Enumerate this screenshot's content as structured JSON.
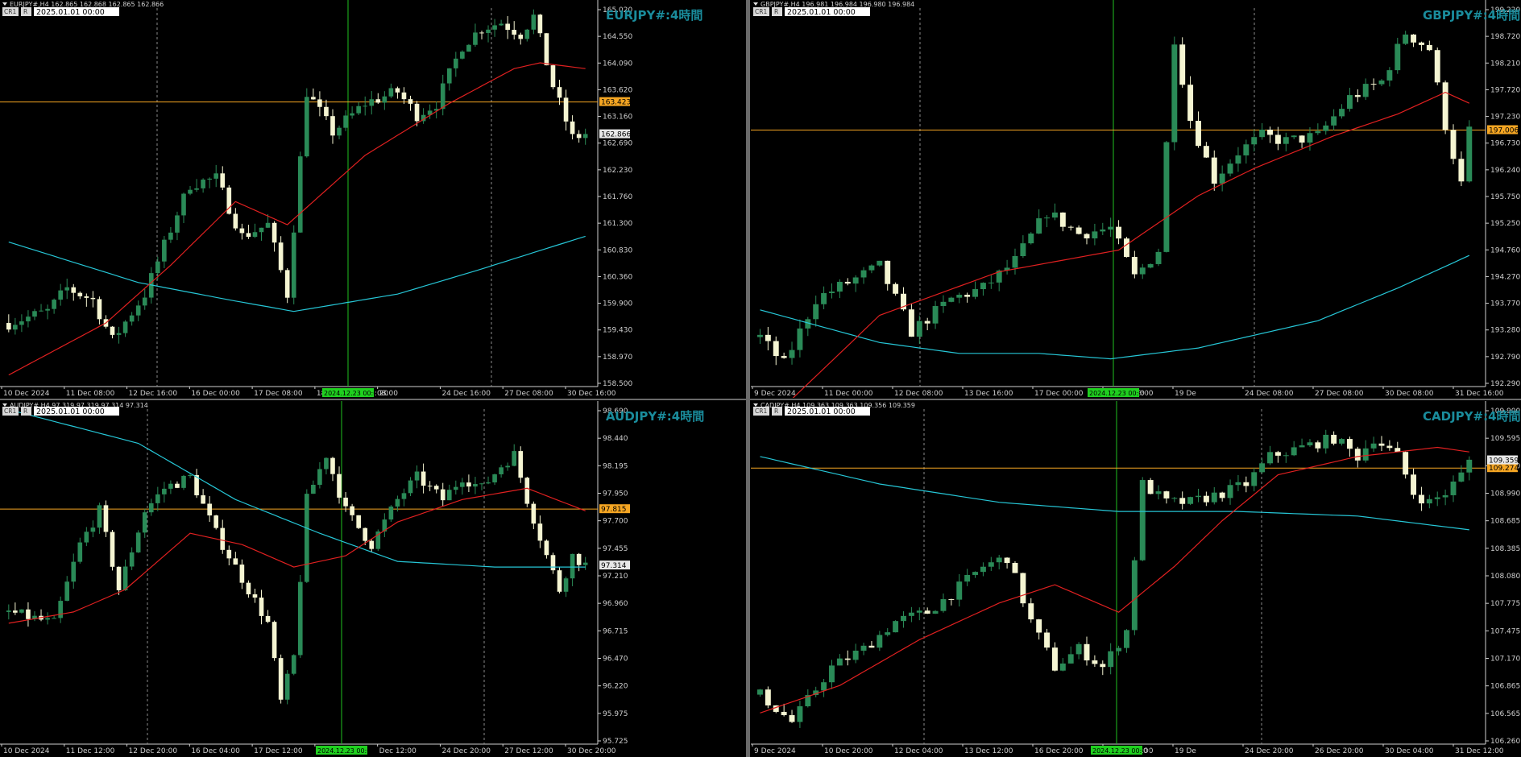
{
  "panes": [
    {
      "id": "eurjpy",
      "header": "EURJPY#,H4  162.865 162.868 162.865 162.866",
      "label": "EURJPY#:4時間",
      "btn_cr": "CR1",
      "btn_r": "R",
      "date_box": "2025.01.01 00:00",
      "price_ticks": [
        "165.020",
        "164.550",
        "164.090",
        "163.620",
        "163.160",
        "162.690",
        "162.230",
        "161.760",
        "161.300",
        "160.830",
        "160.360",
        "159.900",
        "159.430",
        "158.970",
        "158.500"
      ],
      "hline_value": "163.423",
      "current_value": "162.866",
      "time_labels": [
        "10 Dec 2024",
        "11 Dec 08:00",
        "12 Dec 16:00",
        "16 Dec 00:00",
        "17 Dec 08:00",
        "18 Dec 16:00",
        "20",
        "24 Dec 16:00",
        "27 Dec 08:00",
        "30 Dec 16:00"
      ],
      "vline_label": "2024.12.23 00:00",
      "vline_label_tail": ":08:00",
      "chart_data": {
        "type": "candlestick",
        "ylim": [
          158.5,
          165.02
        ],
        "bars": 90,
        "anchors": [
          [
            0,
            159.6
          ],
          [
            6,
            159.8
          ],
          [
            9,
            160.2
          ],
          [
            13,
            160.0
          ],
          [
            16,
            159.3
          ],
          [
            21,
            160.1
          ],
          [
            26,
            161.5
          ],
          [
            28,
            162.0
          ],
          [
            32,
            162.1
          ],
          [
            36,
            161.1
          ],
          [
            40,
            161.3
          ],
          [
            43,
            160.1
          ],
          [
            46,
            163.6
          ],
          [
            50,
            162.9
          ],
          [
            55,
            163.4
          ],
          [
            60,
            163.6
          ],
          [
            63,
            163.2
          ],
          [
            66,
            163.4
          ],
          [
            70,
            164.4
          ],
          [
            73,
            164.7
          ],
          [
            76,
            164.8
          ],
          [
            79,
            164.6
          ],
          [
            81,
            164.9
          ],
          [
            84,
            163.7
          ],
          [
            87,
            162.8
          ],
          [
            89,
            162.87
          ]
        ],
        "ma_fast": [
          [
            0,
            158.7
          ],
          [
            15,
            159.6
          ],
          [
            25,
            160.6
          ],
          [
            35,
            161.7
          ],
          [
            43,
            161.3
          ],
          [
            55,
            162.5
          ],
          [
            68,
            163.4
          ],
          [
            78,
            164.0
          ],
          [
            82,
            164.1
          ],
          [
            89,
            164.0
          ]
        ],
        "ma_slow": [
          [
            0,
            161.0
          ],
          [
            20,
            160.3
          ],
          [
            34,
            160.0
          ],
          [
            44,
            159.8
          ],
          [
            60,
            160.1
          ],
          [
            72,
            160.5
          ],
          [
            89,
            161.1
          ]
        ]
      }
    },
    {
      "id": "gbpjpy",
      "header": "GBPJPY#,H4  196.981 196.984 196.980 196.984",
      "label": "GBPJPY#:4時間",
      "btn_cr": "CR1",
      "btn_r": "R",
      "date_box": "2025.01.01 00:00",
      "price_ticks": [
        "199.220",
        "198.720",
        "198.210",
        "197.720",
        "197.230",
        "196.730",
        "196.240",
        "195.750",
        "195.250",
        "194.760",
        "194.270",
        "193.770",
        "193.280",
        "192.790",
        "192.290"
      ],
      "hline_value": "197.006",
      "current_value": "",
      "time_labels": [
        "9 Dec 2024",
        "11 Dec 00:00",
        "12 Dec 08:00",
        "13 Dec 16:00",
        "17 Dec 00:00",
        "18 Dec 08:00",
        "19 De",
        "24 Dec 08:00",
        "27 Dec 08:00",
        "30 Dec 08:00",
        "31 Dec 16:00"
      ],
      "vline_label": "2024.12.23 00:00",
      "vline_label_tail": "0",
      "chart_data": {
        "type": "candlestick",
        "ylim": [
          192.29,
          199.22
        ],
        "bars": 90,
        "anchors": [
          [
            0,
            193.2
          ],
          [
            3,
            192.7
          ],
          [
            7,
            193.9
          ],
          [
            11,
            194.2
          ],
          [
            15,
            194.5
          ],
          [
            19,
            193.3
          ],
          [
            24,
            193.9
          ],
          [
            28,
            194.1
          ],
          [
            32,
            194.6
          ],
          [
            36,
            195.5
          ],
          [
            40,
            195.1
          ],
          [
            44,
            195.2
          ],
          [
            47,
            194.3
          ],
          [
            50,
            194.8
          ],
          [
            52,
            198.7
          ],
          [
            54,
            197.2
          ],
          [
            57,
            196.1
          ],
          [
            60,
            196.6
          ],
          [
            63,
            196.9
          ],
          [
            66,
            196.8
          ],
          [
            70,
            196.9
          ],
          [
            74,
            197.6
          ],
          [
            78,
            197.9
          ],
          [
            81,
            198.8
          ],
          [
            84,
            198.5
          ],
          [
            86,
            197.1
          ],
          [
            88,
            196.0
          ],
          [
            89,
            196.98
          ]
        ],
        "ma_fast": [
          [
            0,
            191.5
          ],
          [
            15,
            193.6
          ],
          [
            30,
            194.4
          ],
          [
            45,
            194.8
          ],
          [
            55,
            195.8
          ],
          [
            62,
            196.3
          ],
          [
            72,
            196.9
          ],
          [
            80,
            197.3
          ],
          [
            86,
            197.7
          ],
          [
            89,
            197.5
          ]
        ],
        "ma_slow": [
          [
            0,
            193.7
          ],
          [
            15,
            193.1
          ],
          [
            25,
            192.9
          ],
          [
            35,
            192.9
          ],
          [
            44,
            192.8
          ],
          [
            55,
            193.0
          ],
          [
            70,
            193.5
          ],
          [
            80,
            194.1
          ],
          [
            89,
            194.7
          ]
        ]
      }
    },
    {
      "id": "audjpy",
      "header": "AUDJPY#,H4  97.319 97.319 97.314 97.314",
      "label": "AUDJPY#:4時間",
      "btn_cr": "CR1",
      "btn_r": "R",
      "date_box": "2025.01.01 00:00",
      "price_ticks": [
        "98.690",
        "98.440",
        "98.195",
        "97.950",
        "97.700",
        "97.455",
        "97.210",
        "96.960",
        "96.715",
        "96.470",
        "96.220",
        "95.975",
        "95.725"
      ],
      "hline_value": "97.815",
      "current_value": "97.314",
      "time_labels": [
        "10 Dec 2024",
        "11 Dec 12:00",
        "12 Dec 20:00",
        "16 Dec 04:00",
        "17 Dec 12:00",
        "18 Dec 20:00",
        "Dec 12:00",
        "24 Dec 20:00",
        "27 Dec 12:00",
        "30 Dec 20:00"
      ],
      "vline_label": "2024.12.23 00:00",
      "vline_label_tail": "",
      "chart_data": {
        "type": "candlestick",
        "ylim": [
          95.725,
          98.69
        ],
        "bars": 90,
        "anchors": [
          [
            0,
            96.9
          ],
          [
            7,
            96.8
          ],
          [
            11,
            97.5
          ],
          [
            14,
            97.8
          ],
          [
            17,
            97.1
          ],
          [
            21,
            97.8
          ],
          [
            24,
            98.0
          ],
          [
            28,
            98.1
          ],
          [
            32,
            97.6
          ],
          [
            36,
            97.2
          ],
          [
            40,
            96.8
          ],
          [
            42,
            96.1
          ],
          [
            44,
            96.5
          ],
          [
            46,
            97.9
          ],
          [
            49,
            98.3
          ],
          [
            52,
            97.8
          ],
          [
            56,
            97.5
          ],
          [
            60,
            97.9
          ],
          [
            63,
            98.1
          ],
          [
            67,
            97.9
          ],
          [
            70,
            98.1
          ],
          [
            73,
            98.0
          ],
          [
            76,
            98.2
          ],
          [
            78,
            98.3
          ],
          [
            80,
            97.9
          ],
          [
            83,
            97.4
          ],
          [
            85,
            97.1
          ],
          [
            87,
            97.4
          ],
          [
            89,
            97.32
          ]
        ],
        "ma_fast": [
          [
            0,
            96.8
          ],
          [
            10,
            96.9
          ],
          [
            18,
            97.1
          ],
          [
            28,
            97.6
          ],
          [
            36,
            97.5
          ],
          [
            44,
            97.3
          ],
          [
            52,
            97.4
          ],
          [
            60,
            97.7
          ],
          [
            70,
            97.9
          ],
          [
            80,
            98.0
          ],
          [
            89,
            97.8
          ]
        ],
        "ma_slow": [
          [
            0,
            98.7
          ],
          [
            20,
            98.4
          ],
          [
            35,
            97.9
          ],
          [
            48,
            97.6
          ],
          [
            60,
            97.35
          ],
          [
            75,
            97.3
          ],
          [
            89,
            97.3
          ]
        ]
      }
    },
    {
      "id": "cadjpy",
      "header": "CADJPY#,H4  109.363 109.363 109.356 109.359",
      "label": "CADJPY#:4時間",
      "btn_cr": "CR1",
      "btn_r": "R",
      "date_box": "2025.01.01 00:00",
      "price_ticks": [
        "109.900",
        "109.595",
        "109.290",
        "108.990",
        "108.685",
        "108.385",
        "108.080",
        "107.775",
        "107.475",
        "107.170",
        "106.865",
        "106.565",
        "106.260"
      ],
      "hline_value": "109.274",
      "current_value": "109.359",
      "time_labels": [
        "9 Dec 2024",
        "10 Dec 20:00",
        "12 Dec 04:00",
        "13 Dec 12:00",
        "16 Dec 20:00",
        "18 Dec 04:00",
        "19 De",
        "24 Dec 20:00",
        "26 Dec 20:00",
        "30 Dec 04:00",
        "31 Dec 12:00"
      ],
      "vline_label": "2024.12.23 00:00",
      "vline_label_tail": "0",
      "chart_data": {
        "type": "candlestick",
        "ylim": [
          106.26,
          109.9
        ],
        "bars": 90,
        "anchors": [
          [
            0,
            106.8
          ],
          [
            4,
            106.5
          ],
          [
            9,
            107.1
          ],
          [
            13,
            107.3
          ],
          [
            17,
            107.6
          ],
          [
            21,
            107.7
          ],
          [
            24,
            107.9
          ],
          [
            28,
            108.2
          ],
          [
            31,
            108.3
          ],
          [
            34,
            107.6
          ],
          [
            37,
            107.1
          ],
          [
            40,
            107.3
          ],
          [
            43,
            107.1
          ],
          [
            46,
            107.5
          ],
          [
            48,
            109.1
          ],
          [
            51,
            108.9
          ],
          [
            54,
            108.9
          ],
          [
            58,
            109.0
          ],
          [
            61,
            109.1
          ],
          [
            64,
            109.4
          ],
          [
            68,
            109.5
          ],
          [
            72,
            109.6
          ],
          [
            75,
            109.4
          ],
          [
            77,
            109.6
          ],
          [
            80,
            109.4
          ],
          [
            82,
            109.0
          ],
          [
            84,
            108.9
          ],
          [
            86,
            109.0
          ],
          [
            88,
            109.2
          ],
          [
            89,
            109.36
          ]
        ],
        "ma_fast": [
          [
            0,
            106.6
          ],
          [
            10,
            106.9
          ],
          [
            20,
            107.4
          ],
          [
            30,
            107.8
          ],
          [
            37,
            108.0
          ],
          [
            45,
            107.7
          ],
          [
            52,
            108.2
          ],
          [
            58,
            108.7
          ],
          [
            65,
            109.2
          ],
          [
            75,
            109.4
          ],
          [
            85,
            109.5
          ],
          [
            89,
            109.45
          ]
        ],
        "ma_slow": [
          [
            0,
            109.4
          ],
          [
            15,
            109.1
          ],
          [
            30,
            108.9
          ],
          [
            45,
            108.8
          ],
          [
            60,
            108.8
          ],
          [
            75,
            108.75
          ],
          [
            89,
            108.6
          ]
        ]
      }
    }
  ],
  "colors": {
    "bull": "#2a8a57",
    "bear": "#f5f5d2",
    "ma_fast": "#e02020",
    "ma_slow": "#26c6d6",
    "hline": "#f5a623",
    "vline": "#1fbf1f",
    "grid_v": "#8a8a8a",
    "axis_text": "#cfcfcf",
    "label": "#1a8c9c",
    "vlabel_bg": "#1fd01f"
  }
}
